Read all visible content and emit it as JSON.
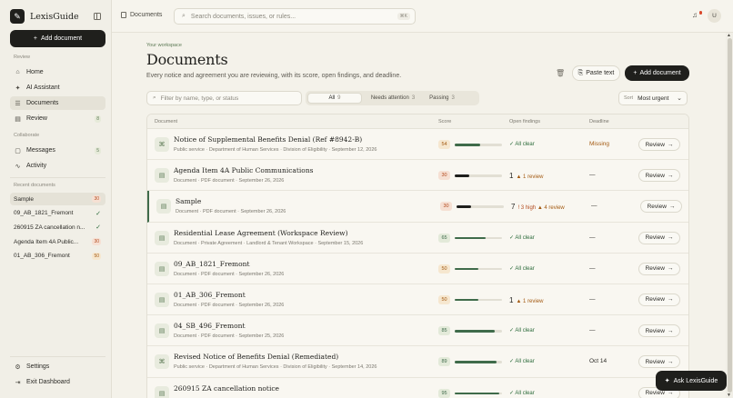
{
  "app": {
    "name": "LexisGuide",
    "logo_glyph": "✎"
  },
  "sidebar": {
    "add_document_label": "Add document",
    "sections": {
      "review": "Review",
      "collaborate": "Collaborate",
      "recent": "Recent documents"
    },
    "review_items": [
      {
        "label": "Home",
        "icon": "home-icon",
        "glyph": "⌂"
      },
      {
        "label": "AI Assistant",
        "icon": "sparkle-icon",
        "glyph": "✦"
      },
      {
        "label": "Documents",
        "icon": "document-icon",
        "glyph": "☰"
      },
      {
        "label": "Review",
        "icon": "review-icon",
        "glyph": "▤",
        "count": "8"
      }
    ],
    "collab_items": [
      {
        "label": "Messages",
        "icon": "message-icon",
        "glyph": "▢",
        "count": "5"
      },
      {
        "label": "Activity",
        "icon": "activity-icon",
        "glyph": "∿"
      }
    ],
    "recent": [
      {
        "label": "Sample",
        "badge": "30"
      },
      {
        "label": "09_AB_1821_Fremont",
        "check": "✓"
      },
      {
        "label": "260915 ZA cancellation n...",
        "check": "✓"
      },
      {
        "label": "Agenda Item 4A Public...",
        "badge": "30"
      },
      {
        "label": "01_AB_306_Fremont",
        "badge": "50"
      }
    ],
    "settings_label": "Settings",
    "exit_label": "Exit Dashboard"
  },
  "topbar": {
    "breadcrumb": "Documents",
    "search_placeholder": "Search documents, issues, or rules...",
    "search_shortcut": "⌘K",
    "avatar_initial": "U"
  },
  "main": {
    "eyebrow": "Your workspace",
    "title": "Documents",
    "subtitle": "Every notice and agreement you are reviewing, with its score, open findings, and deadline.",
    "paste_label": "Paste text",
    "add_label": "Add document",
    "filter_placeholder": "Filter by name, type, or status",
    "tabs": [
      {
        "label": "All",
        "count": "9"
      },
      {
        "label": "Needs attention",
        "count": "3"
      },
      {
        "label": "Passing",
        "count": "3"
      }
    ],
    "sort_label": "Sort",
    "sort_value": "Most urgent"
  },
  "table": {
    "columns": {
      "document": "Document",
      "score": "Score",
      "findings": "Open findings",
      "deadline": "Deadline"
    },
    "review_label": "Review",
    "rows": [
      {
        "icon": "⌘",
        "title": "Notice of Supplemental Benefits Denial (Ref #8942-B)",
        "meta": "Public service · Department of Human Services · Division of Eligibility · September 12, 2026",
        "score": "54",
        "score_pct": 0.54,
        "findings_clear": "✓ All clear",
        "deadline": "Missing",
        "deadline_missing": true
      },
      {
        "icon": "▤",
        "title": "Agenda Item 4A Public Communications",
        "meta": "Document · PDF document · September 26, 2026",
        "score": "30",
        "score_pct": 0.3,
        "findings_num": "1",
        "findings_review": "▲ 1 review",
        "deadline": "—"
      },
      {
        "icon": "▤",
        "title": "Sample",
        "meta": "Document · PDF document · September 26, 2026",
        "score": "30",
        "score_pct": 0.3,
        "findings_num": "7",
        "findings_high": "! 3 high",
        "findings_review": "▲ 4 review",
        "deadline": "—",
        "selected": true
      },
      {
        "icon": "▤",
        "title": "Residential Lease Agreement (Workspace Review)",
        "meta": "Document · Private Agreement · Landlord & Tenant Workspace · September 15, 2026",
        "score": "65",
        "score_pct": 0.65,
        "findings_clear": "✓ All clear",
        "deadline": "—"
      },
      {
        "icon": "▤",
        "title": "09_AB_1821_Fremont",
        "meta": "Document · PDF document · September 26, 2026",
        "score": "50",
        "score_pct": 0.5,
        "findings_clear": "✓ All clear",
        "deadline": "—"
      },
      {
        "icon": "▤",
        "title": "01_AB_306_Fremont",
        "meta": "Document · PDF document · September 26, 2026",
        "score": "50",
        "score_pct": 0.5,
        "findings_num": "1",
        "findings_review": "▲ 1 review",
        "deadline": "—"
      },
      {
        "icon": "▤",
        "title": "04_SB_496_Fremont",
        "meta": "Document · PDF document · September 25, 2026",
        "score": "85",
        "score_pct": 0.85,
        "findings_clear": "✓ All clear",
        "deadline": "—"
      },
      {
        "icon": "⌘",
        "title": "Revised Notice of Benefits Denial (Remediated)",
        "meta": "Public service · Department of Human Services · Division of Eligibility · September 14, 2026",
        "score": "89",
        "score_pct": 0.89,
        "findings_clear": "✓ All clear",
        "deadline": "Oct 14"
      },
      {
        "icon": "▤",
        "title": "260915 ZA cancellation notice",
        "meta": "",
        "score": "95",
        "score_pct": 0.95,
        "findings_clear": "✓ All clear",
        "deadline": ""
      }
    ]
  },
  "ask_label": "Ask LexisGuide",
  "colors": {
    "accent_dark": "#1f1f1c",
    "score_red": "#b34b1f",
    "score_green": "#3f6b4a",
    "score_amber": "#a35a12"
  }
}
